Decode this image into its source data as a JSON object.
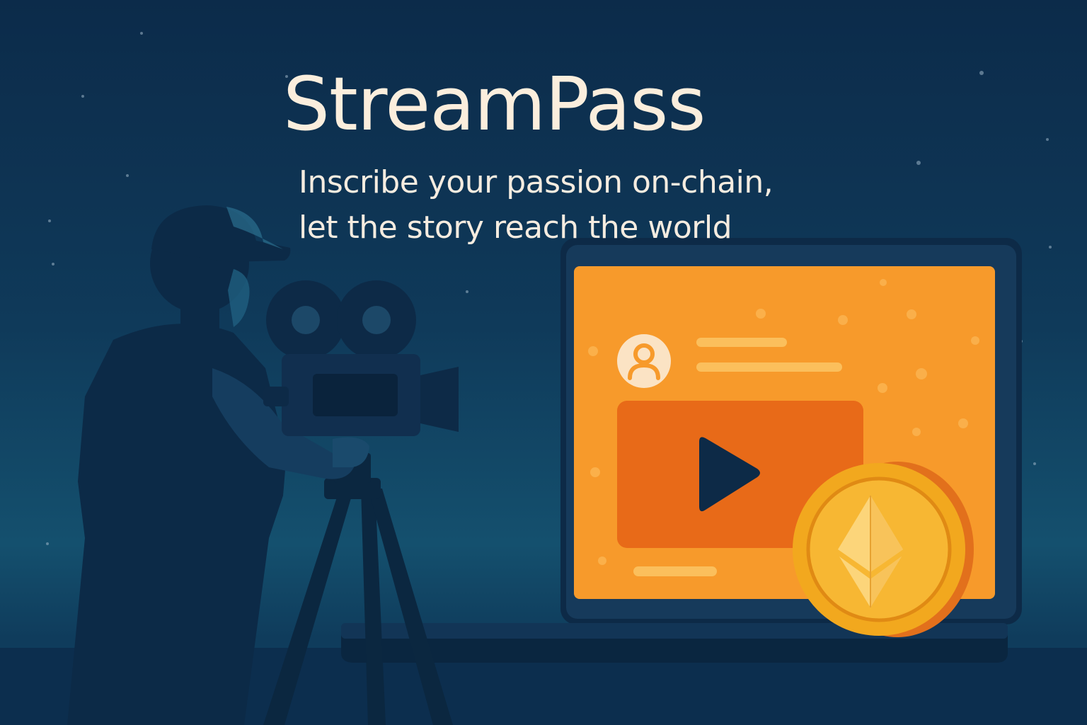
{
  "poster": {
    "title": "StreamPass",
    "tagline": {
      "line1": "Inscribe your passion on-chain,",
      "line2": "let the story reach the world"
    }
  },
  "illustration": {
    "icons": [
      "camera-operator-icon",
      "film-camera-icon",
      "tripod-icon",
      "laptop-icon",
      "play-icon",
      "profile-avatar-icon",
      "ethereum-coin-icon"
    ],
    "colors": {
      "sky_top": "#0c2b4a",
      "sky_bottom": "#14506e",
      "silhouette": "#0c2a47",
      "screen_orange": "#f79a2b",
      "video_panel": "#e86a18",
      "coin_gold": "#f2a81e",
      "text_cream": "#fbeedd"
    }
  }
}
